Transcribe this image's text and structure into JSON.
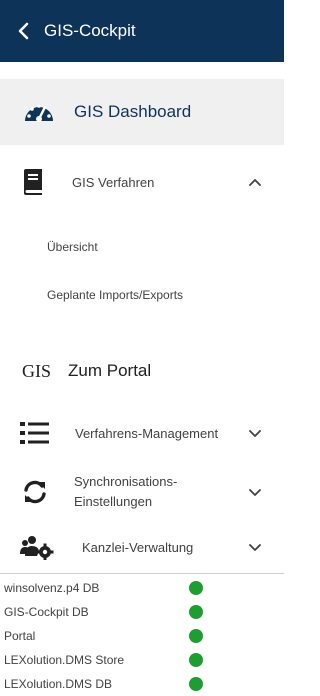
{
  "header": {
    "title": "GIS-Cockpit"
  },
  "nav": {
    "dashboard": {
      "label": "GIS Dashboard"
    },
    "verfahren": {
      "label": "GIS Verfahren",
      "expanded": true,
      "children": [
        {
          "label": "Übersicht"
        },
        {
          "label": "Geplante Imports/Exports"
        }
      ]
    },
    "portal": {
      "logo_text": "GIS",
      "label": "Zum Portal"
    },
    "management": {
      "label": "Verfahrens-Management"
    },
    "sync": {
      "label_line1": "Synchronisations-",
      "label_line2": "Einstellungen"
    },
    "kanzlei": {
      "label": "Kanzlei-Verwaltung"
    }
  },
  "status": {
    "color_ok": "#1e9e2e",
    "items": [
      {
        "name": "winsolvenz.p4 DB",
        "state": "ok"
      },
      {
        "name": "GIS-Cockpit DB",
        "state": "ok"
      },
      {
        "name": "Portal",
        "state": "ok"
      },
      {
        "name": "LEXolution.DMS Store",
        "state": "ok"
      },
      {
        "name": "LEXolution.DMS DB",
        "state": "ok"
      }
    ]
  },
  "colors": {
    "header_bg": "#0e3358",
    "accent": "#0e3358"
  }
}
